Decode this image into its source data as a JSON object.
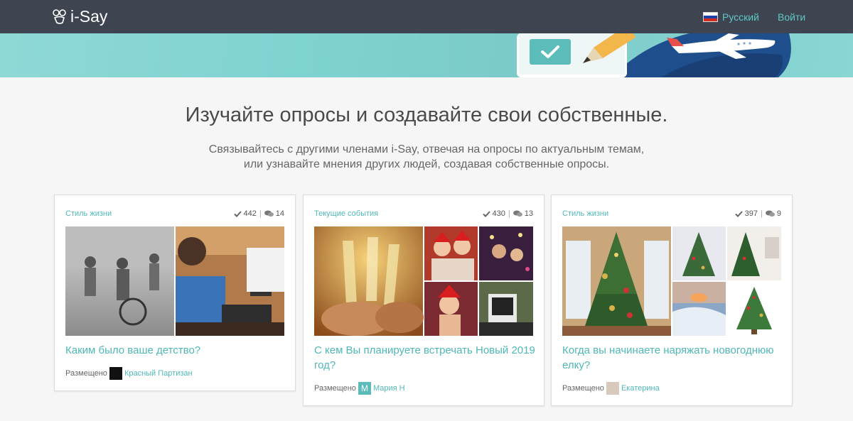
{
  "header": {
    "logo_text": "i-Say",
    "language_label": "Русский",
    "login_label": "Войти"
  },
  "hero": {
    "title": "Изучайте опросы и создавайте свои собственные.",
    "subtitle_line1": "Связывайтесь с другими членами i-Say, отвечая на опросы по актуальным темам,",
    "subtitle_line2": "или узнавайте мнения других людей, создавая собственные опросы."
  },
  "cards": [
    {
      "category": "Стиль жизни",
      "answers": "442",
      "comments": "14",
      "question": "Каким было ваше детство?",
      "posted_label": "Размещено",
      "author": "Красный Партизан"
    },
    {
      "category": "Текущие события",
      "answers": "430",
      "comments": "13",
      "question": "С кем Вы планируете встречать Новый 2019 год?",
      "posted_label": "Размещено",
      "author": "Мария Н"
    },
    {
      "category": "Стиль жизни",
      "answers": "397",
      "comments": "9",
      "question": "Когда вы начинаете наряжать новогоднюю елку?",
      "posted_label": "Размещено",
      "author": "Екатерина"
    }
  ],
  "colors": {
    "accent": "#4fb8b6",
    "header_bg": "#3f4550",
    "banner_bg": "#7fd3d1"
  },
  "icons": [
    "logo-icon",
    "russian-flag-icon",
    "check-icon",
    "comments-icon",
    "avatar"
  ]
}
